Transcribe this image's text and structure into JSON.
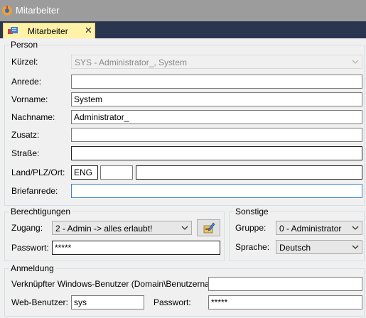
{
  "window": {
    "title": "Mitarbeiter"
  },
  "tab": {
    "label": "Mitarbeiter",
    "close": "✕"
  },
  "person": {
    "legend": "Person",
    "kuerzel_label": "Kürzel:",
    "kuerzel_value": "SYS - Administrator_, System",
    "anrede_label": "Anrede:",
    "anrede_value": "",
    "vorname_label": "Vorname:",
    "vorname_value": "System",
    "nachname_label": "Nachname:",
    "nachname_value": "Administrator_",
    "zusatz_label": "Zusatz:",
    "zusatz_value": "",
    "strasse_label": "Straße:",
    "strasse_value": "",
    "land_label": "Land/PLZ/Ort:",
    "land_value": "ENG",
    "plz_value": "",
    "ort_value": "",
    "briefanrede_label": "Briefanrede:",
    "briefanrede_value": ""
  },
  "berechtigungen": {
    "legend": "Berechtigungen",
    "zugang_label": "Zugang:",
    "zugang_value": "2 - Admin -> alles erlaubt!",
    "passwort_label": "Passwort:",
    "passwort_value": "*****"
  },
  "sonstige": {
    "legend": "Sonstige",
    "gruppe_label": "Gruppe:",
    "gruppe_value": "0 - Administrator",
    "sprache_label": "Sprache:",
    "sprache_value": "Deutsch"
  },
  "anmeldung": {
    "legend": "Anmeldung",
    "windows_user_label": "Verknüpfter Windows-Benutzer (Domain\\Benutzername):",
    "windows_user_value": "",
    "web_user_label": "Web-Benutzer:",
    "web_user_value": "sys",
    "passwort_label": "Passwort:",
    "passwort_value": "*****"
  },
  "icons": {
    "app": "app-icon",
    "tab": "document-icon",
    "edit": "edit-pencil-icon",
    "dropdown": "chevron-down-icon"
  }
}
